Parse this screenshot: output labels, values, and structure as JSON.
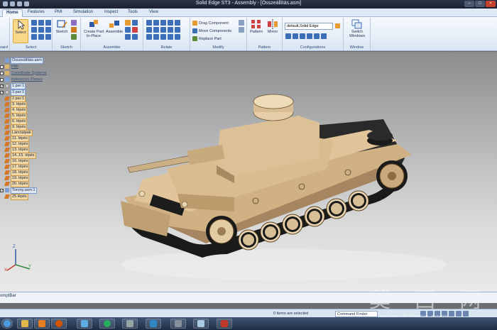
{
  "window": {
    "title": "Solid Edge ST3 - Assembly - [Összeállítás.asm]"
  },
  "tabs": [
    {
      "label": "Home"
    },
    {
      "label": "Features"
    },
    {
      "label": "PMI"
    },
    {
      "label": "Simulation"
    },
    {
      "label": "Inspect"
    },
    {
      "label": "Tools"
    },
    {
      "label": "View"
    }
  ],
  "ribbon": {
    "clipboard_label": "oard",
    "select": {
      "label": "Select",
      "group": "Select"
    },
    "sketch": {
      "label": "Sketch",
      "group": "Sketch"
    },
    "assemble": {
      "create_part": "Create Part In-Place",
      "assemble": "Assemble",
      "group": "Assemble"
    },
    "relate": {
      "group": "Relate"
    },
    "modify": {
      "drag": "Drag Component",
      "move": "Move Components",
      "replace": "Replace Part",
      "group": "Modify"
    },
    "pattern": {
      "pattern": "Pattern",
      "mirror": "Mirror",
      "group": "Pattern"
    },
    "configurations": {
      "value": "default,Solid Edge",
      "group": "Configurations"
    },
    "window": {
      "switch": "Switch Windows",
      "group": "Window"
    }
  },
  "tree": [
    {
      "label": "Összeállítás.asm",
      "icon": "asm",
      "check": false,
      "style": "sel"
    },
    {
      "label": "PMI",
      "icon": "folder",
      "check": false,
      "style": "mut"
    },
    {
      "label": "Coordinate Systems",
      "icon": "folder",
      "check": false,
      "style": "mut"
    },
    {
      "label": "Reference Planes",
      "icon": "plane",
      "check": false,
      "style": "mut"
    },
    {
      "label": "1.par:1",
      "icon": "part",
      "check": true,
      "style": "sel"
    },
    {
      "label": "3.par:1",
      "icon": "part",
      "check": true,
      "style": "sel"
    },
    {
      "label": "2.par:1",
      "icon": "step",
      "check": false,
      "style": "hl"
    },
    {
      "label": "3. lépés",
      "icon": "step",
      "check": false,
      "style": "hl"
    },
    {
      "label": "4. lépés",
      "icon": "step",
      "check": false,
      "style": "hl"
    },
    {
      "label": "5. lépés",
      "icon": "step",
      "check": false,
      "style": "hl"
    },
    {
      "label": "6. lépés",
      "icon": "step",
      "check": false,
      "style": "hl"
    },
    {
      "label": "9. lépés",
      "icon": "step",
      "check": false,
      "style": "hl"
    },
    {
      "label": "Lánctalpak",
      "icon": "step",
      "check": false,
      "style": "hl"
    },
    {
      "label": "11. lépés",
      "icon": "step",
      "check": false,
      "style": "hl"
    },
    {
      "label": "12. lépés",
      "icon": "step",
      "check": false,
      "style": "hl"
    },
    {
      "label": "13. lépés",
      "icon": "step",
      "check": false,
      "style": "hl"
    },
    {
      "label": "14.,15. lépés",
      "icon": "step",
      "check": false,
      "style": "hl"
    },
    {
      "label": "16. lépés",
      "icon": "step",
      "check": false,
      "style": "hl"
    },
    {
      "label": "17. lépés",
      "icon": "step",
      "check": false,
      "style": "hl"
    },
    {
      "label": "18. lépés",
      "icon": "step",
      "check": false,
      "style": "hl"
    },
    {
      "label": "19. lépés",
      "icon": "step",
      "check": false,
      "style": "hl"
    },
    {
      "label": "20. lépés",
      "icon": "step",
      "check": false,
      "style": "hl"
    },
    {
      "label": "Torony.asm:1",
      "icon": "asm",
      "check": true,
      "style": "sel"
    },
    {
      "label": "25.lépés",
      "icon": "step",
      "check": false,
      "style": "hl"
    }
  ],
  "prompt": {
    "label": "omptBar"
  },
  "status": {
    "items_selected": "0 items are selected",
    "command_finder": "Command Finder"
  },
  "axes": {
    "z": "Z",
    "x": "X",
    "y": "Y"
  },
  "watermark": {
    "big": "莫 西 网",
    "small": "www.3dmox.com"
  },
  "colors": {
    "tank_body": "#d8b98a",
    "tank_shadow": "#9c7c55",
    "track": "#1a1a1a",
    "ribbon_accent": "#3d6fb8"
  }
}
